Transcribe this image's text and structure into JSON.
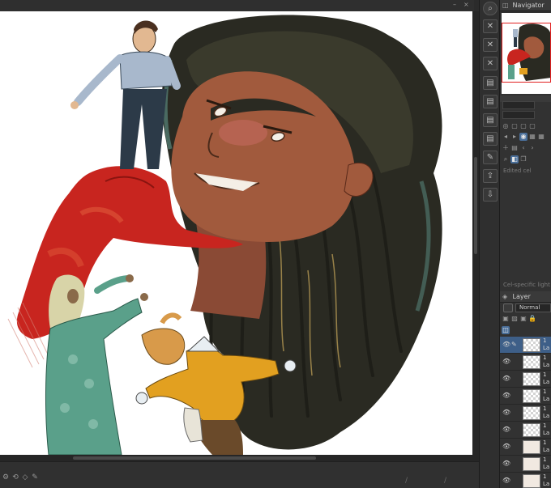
{
  "app": {
    "accent": "#3e5f88",
    "canvas_background": "#ffffff"
  },
  "navigator": {
    "title": "Navigator",
    "icon": "navigator-icon"
  },
  "frame_panel": {
    "status_text": "Edited cel",
    "setting_label": "Cel-specific light tab"
  },
  "layer_panel": {
    "title": "Layer",
    "blend_mode": "Normal",
    "layers": [
      {
        "num": "1",
        "name": "La",
        "selected": true,
        "thumb": "checker"
      },
      {
        "num": "1",
        "name": "La",
        "selected": false,
        "thumb": "checker"
      },
      {
        "num": "1",
        "name": "La",
        "selected": false,
        "thumb": "checker"
      },
      {
        "num": "1",
        "name": "La",
        "selected": false,
        "thumb": "checker"
      },
      {
        "num": "1",
        "name": "La",
        "selected": false,
        "thumb": "checker"
      },
      {
        "num": "1",
        "name": "La",
        "selected": false,
        "thumb": "checker"
      },
      {
        "num": "1",
        "name": "La",
        "selected": false,
        "thumb": "art"
      },
      {
        "num": "1",
        "name": "La",
        "selected": false,
        "thumb": "art"
      },
      {
        "num": "1",
        "name": "La",
        "selected": false,
        "thumb": "art"
      }
    ]
  },
  "tools": [
    "zoom-icon",
    "close-cel-icon",
    "close-cel-icon",
    "close-cel-icon",
    "layer-icon",
    "layer-icon",
    "layer-icon",
    "layer-icon",
    "layer-icon",
    "edit-icon",
    "export-icon",
    "import-icon"
  ]
}
